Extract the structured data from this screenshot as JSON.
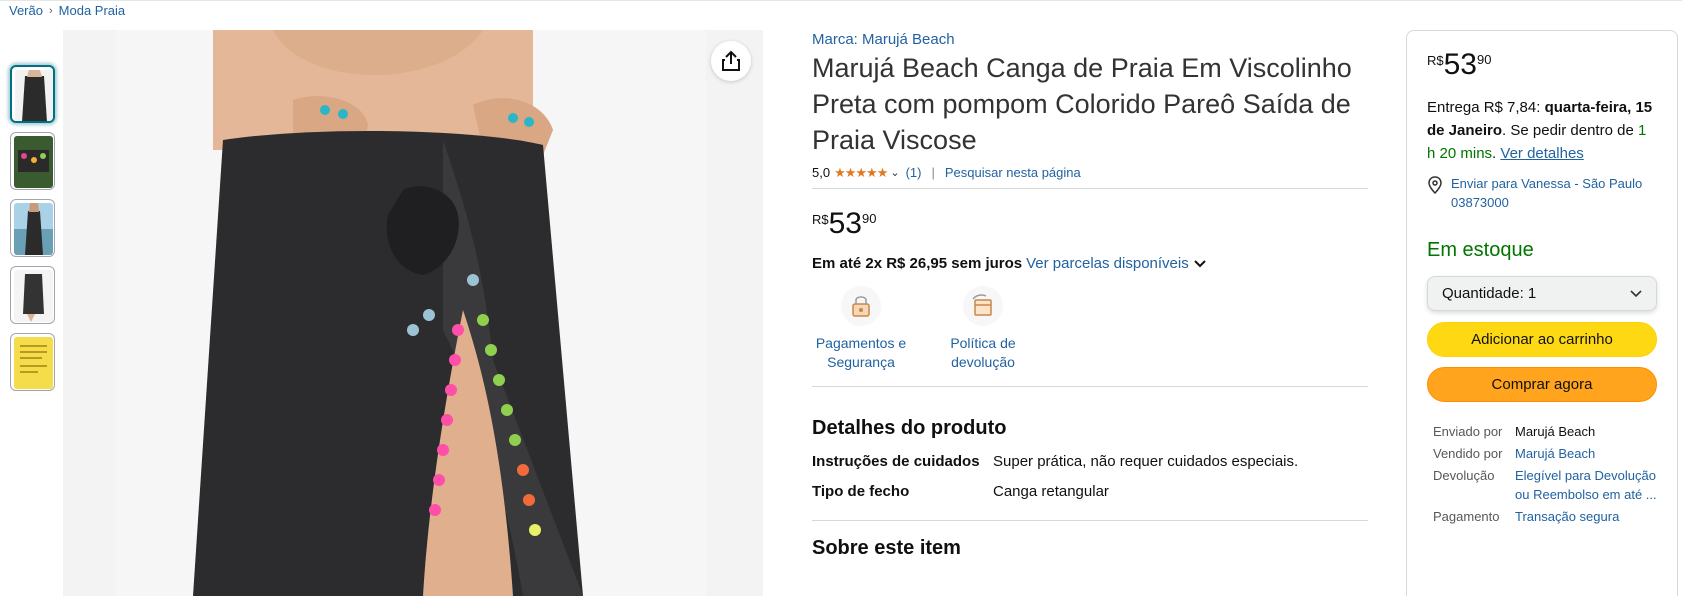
{
  "breadcrumb": {
    "items": [
      "Verão",
      "Moda Praia"
    ],
    "separator": "›"
  },
  "gallery": {
    "thumbnails": [
      {
        "name": "thumb-black-canga",
        "color": "#2b2b2b"
      },
      {
        "name": "thumb-green-lifestyle",
        "color": "#3a5a30"
      },
      {
        "name": "thumb-beach",
        "color": "#8ab7c7"
      },
      {
        "name": "thumb-black-side",
        "color": "#3a3a3a"
      },
      {
        "name": "thumb-yellow-card",
        "color": "#f5dc4a"
      }
    ],
    "active_index": 0
  },
  "product": {
    "brand": "Marca: Marujá Beach",
    "title": "Marujá Beach Canga de Praia Em Viscolinho Preta com pompom Colorido Pareô Saída de Praia Viscose",
    "rating_value": "5,0",
    "stars": "★★★★★",
    "rating_count": "(1)",
    "search_page": "Pesquisar nesta página",
    "price": {
      "currency": "R$",
      "whole": "53",
      "fraction": "90"
    },
    "installments_bold": "Em até 2x R$ 26,95 sem juros",
    "installments_link": "Ver parcelas disponíveis",
    "badges": [
      {
        "label": "Pagamentos e Segurança",
        "icon": "lock-icon"
      },
      {
        "label": "Política de devolução",
        "icon": "return-box-icon"
      }
    ]
  },
  "details": {
    "heading": "Detalhes do produto",
    "rows": [
      {
        "key": "Instruções de cuidados",
        "value": "Super prática, não requer cuidados especiais."
      },
      {
        "key": "Tipo de fecho",
        "value": "Canga retangular"
      }
    ],
    "about_heading": "Sobre este item"
  },
  "buybox": {
    "price": {
      "currency": "R$",
      "whole": "53",
      "fraction": "90"
    },
    "delivery_prefix": "Entrega R$ 7,84:",
    "delivery_date": "quarta-feira, 15 de Janeiro",
    "delivery_mid": ". Se pedir dentro de",
    "delivery_time": "1 h 20 mins",
    "delivery_link": "Ver detalhes",
    "ship_to": "Enviar para Vanessa - São Paulo 03873000",
    "stock": "Em estoque",
    "quantity_label": "Quantidade:",
    "quantity_value": "1",
    "add_to_cart": "Adicionar ao carrinho",
    "buy_now": "Comprar agora",
    "seller_info": {
      "shipped_by_label": "Enviado por",
      "shipped_by": "Marujá Beach",
      "sold_by_label": "Vendido por",
      "sold_by": "Marujá Beach",
      "return_label": "Devolução",
      "return_value": "Elegível para Devolução ou Reembolso em até ...",
      "payment_label": "Pagamento",
      "payment_value": "Transação segura"
    }
  },
  "colors": {
    "link": "#2162a1",
    "stars": "#de7921",
    "in_stock": "#007600",
    "cart_button": "#ffd814",
    "buy_button": "#ffa41c"
  }
}
